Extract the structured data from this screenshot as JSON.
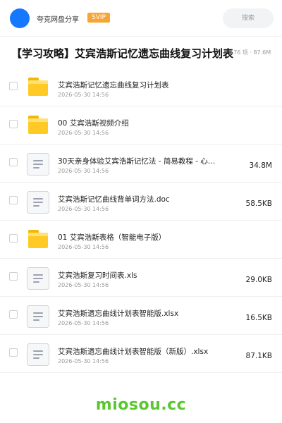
{
  "header": {
    "username": "夸克网盘分享",
    "badge": "SVIP",
    "search_label": "搜索",
    "avatar_color": "#1677ff"
  },
  "share": {
    "title": "【学习攻略】艾宾浩斯记忆遗忘曲线复习计划表",
    "meta": "176 项 · 87.6M"
  },
  "files": [
    {
      "icon": "folder-icon",
      "name": "艾宾浩斯记忆遗忘曲线复习计划表",
      "date": "2026-05-30 14:56",
      "size": ""
    },
    {
      "icon": "folder-icon",
      "name": "00 艾宾浩斯视频介绍",
      "date": "2026-05-30 14:56",
      "size": ""
    },
    {
      "icon": "document-icon",
      "name": "30天亲身体验艾宾浩斯记忆法 - 简易教程 - 心…",
      "date": "2026-05-30 14:56",
      "size": "34.8M"
    },
    {
      "icon": "document-icon",
      "name": "艾宾浩斯记忆曲线背单词方法.doc",
      "date": "2026-05-30 14:56",
      "size": "58.5KB"
    },
    {
      "icon": "folder-icon",
      "name": "01 艾宾浩斯表格（智能电子版）",
      "date": "2026-05-30 14:56",
      "size": ""
    },
    {
      "icon": "document-icon",
      "name": "艾宾浩斯复习时间表.xls",
      "date": "2026-05-30 14:56",
      "size": "29.0KB"
    },
    {
      "icon": "document-icon",
      "name": "艾宾浩斯遗忘曲线计划表智能版.xlsx",
      "date": "2026-05-30 14:56",
      "size": "16.5KB"
    },
    {
      "icon": "document-icon",
      "name": "艾宾浩斯遗忘曲线计划表智能版（新版）.xlsx",
      "date": "2026-05-30 14:56",
      "size": "87.1KB"
    }
  ],
  "watermark": "miosou.cc",
  "colors": {
    "badge": "#f7a534",
    "folder": "#ffc926",
    "watermark": "#5ac72f"
  }
}
